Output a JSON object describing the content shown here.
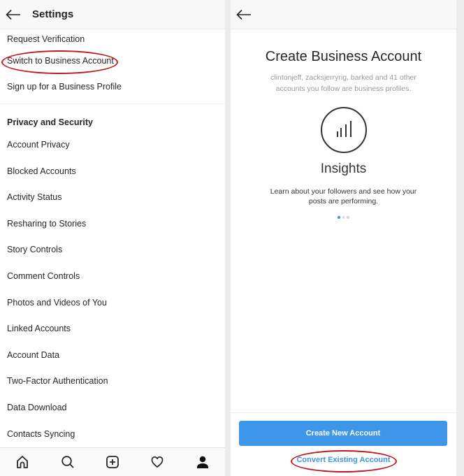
{
  "settings_screen": {
    "header": {
      "title": "Settings",
      "back_icon": "arrow-left-icon"
    },
    "account_items": [
      {
        "label": "Request Verification"
      },
      {
        "label": "Switch to Business Account",
        "highlighted": true
      },
      {
        "label": "Sign up for a Business Profile"
      }
    ],
    "privacy_section": {
      "heading": "Privacy and Security",
      "items": [
        {
          "label": "Account Privacy"
        },
        {
          "label": "Blocked Accounts"
        },
        {
          "label": "Activity Status"
        },
        {
          "label": "Resharing to Stories"
        },
        {
          "label": "Story Controls"
        },
        {
          "label": "Comment Controls"
        },
        {
          "label": "Photos and Videos of You"
        },
        {
          "label": "Linked Accounts"
        },
        {
          "label": "Account Data"
        },
        {
          "label": "Two-Factor Authentication"
        },
        {
          "label": "Data Download"
        },
        {
          "label": "Contacts Syncing"
        }
      ]
    },
    "tab_bar": [
      {
        "name": "home",
        "icon": "home-icon"
      },
      {
        "name": "search",
        "icon": "search-icon"
      },
      {
        "name": "new-post",
        "icon": "plus-square-icon"
      },
      {
        "name": "activity",
        "icon": "heart-icon"
      },
      {
        "name": "profile",
        "icon": "person-icon",
        "active": true
      }
    ]
  },
  "business_screen": {
    "header": {
      "back_icon": "arrow-left-icon"
    },
    "title": "Create Business Account",
    "subtitle": "clintonjeff, zacksjerryrig, barked and 41 other accounts you follow are business profiles.",
    "feature": {
      "icon": "bar-chart-icon",
      "title": "Insights",
      "description": "Learn about your followers and see how your posts are performing."
    },
    "pager": {
      "count": 3,
      "active_index": 0
    },
    "primary_button": "Create New Account",
    "secondary_link": "Convert Existing Account",
    "annotation_color": "#c4171d",
    "accent_color": "#3d96ea"
  }
}
